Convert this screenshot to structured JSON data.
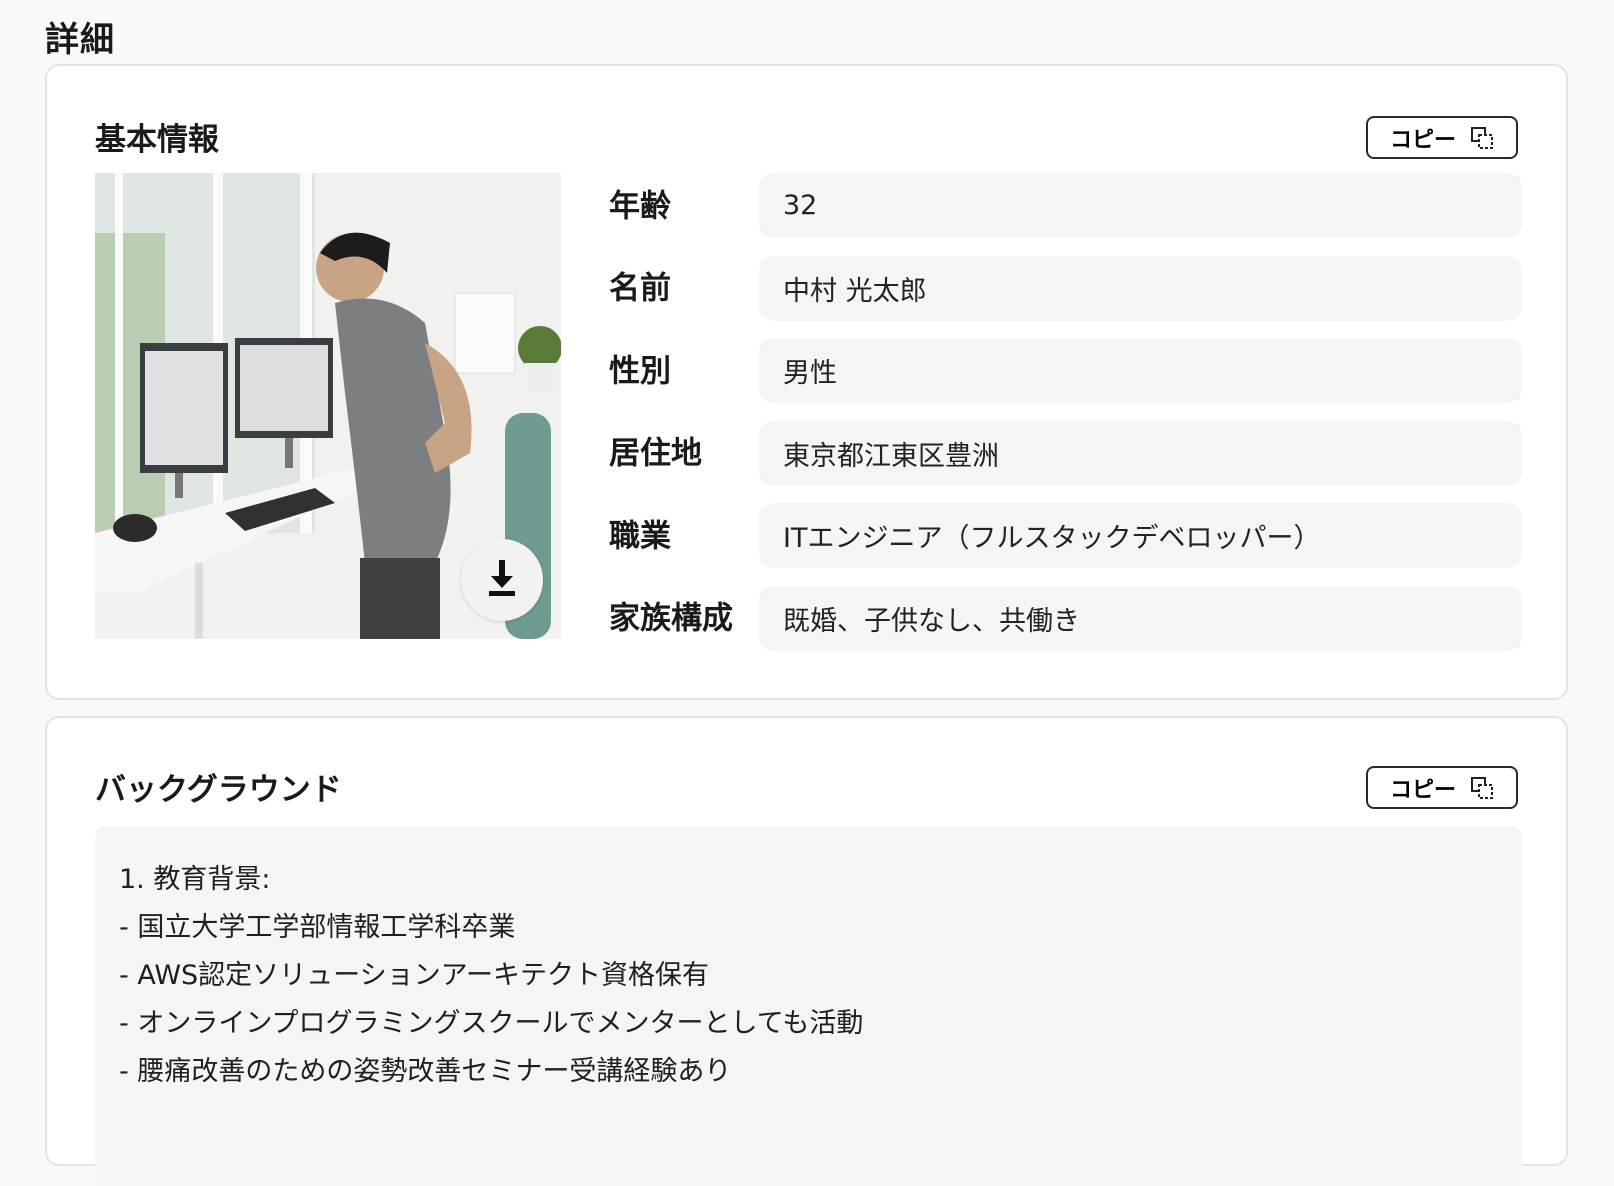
{
  "page": {
    "title": "詳細"
  },
  "basic_info": {
    "title": "基本情報",
    "copy_label": "コピー",
    "photo_icon": "download-icon",
    "fields": [
      {
        "label": "年齢",
        "value": "32"
      },
      {
        "label": "名前",
        "value": "中村 光太郎"
      },
      {
        "label": "性別",
        "value": "男性"
      },
      {
        "label": "居住地",
        "value": "東京都江東区豊洲"
      },
      {
        "label": "職業",
        "value": "ITエンジニア（フルスタックデベロッパー）"
      },
      {
        "label": "家族構成",
        "value": "既婚、子供なし、共働き"
      }
    ]
  },
  "background": {
    "title": "バックグラウンド",
    "copy_label": "コピー",
    "lines": [
      "1. 教育背景:",
      "- 国立大学工学部情報工学科卒業",
      "- AWS認定ソリューションアーキテクト資格保有",
      "- オンラインプログラミングスクールでメンターとしても活動",
      "- 腰痛改善のための姿勢改善セミナー受講経験あり"
    ]
  }
}
